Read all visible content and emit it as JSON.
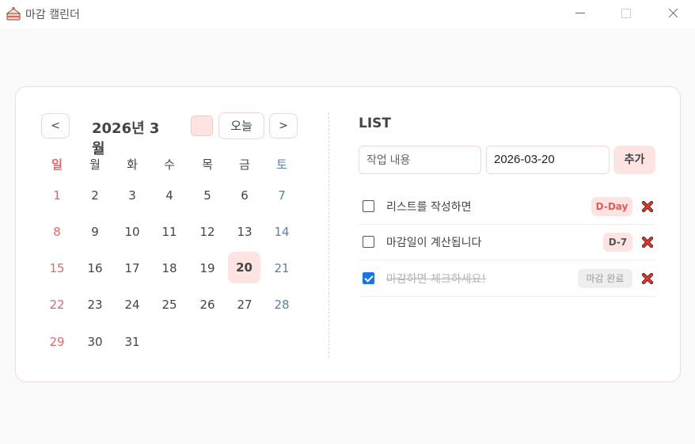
{
  "window": {
    "title": "마감 캘린더",
    "icons": {
      "app": "cake-icon",
      "minimize": "minimize-icon",
      "maximize": "maximize-icon",
      "close": "close-icon"
    }
  },
  "calendar": {
    "prev_label": "<",
    "next_label": ">",
    "title": "2026년 3월",
    "today_label": "오늘",
    "weekdays": [
      "일",
      "월",
      "화",
      "수",
      "목",
      "금",
      "토"
    ],
    "days": [
      "1",
      "2",
      "3",
      "4",
      "5",
      "6",
      "7",
      "8",
      "9",
      "10",
      "11",
      "12",
      "13",
      "14",
      "15",
      "16",
      "17",
      "18",
      "19",
      "20",
      "21",
      "22",
      "23",
      "24",
      "25",
      "26",
      "27",
      "28",
      "29",
      "30",
      "31"
    ],
    "selected_day": "20",
    "colors": {
      "sunday": "#e16868",
      "saturday": "#5a7fa6",
      "highlight": "#fde3e1"
    }
  },
  "list": {
    "title": "LIST",
    "task_placeholder": "작업 내용",
    "date_value": "2026-03-20",
    "add_label": "추가",
    "items": [
      {
        "text": "리스트를 작성하면",
        "badge": "D-Day",
        "checked": false
      },
      {
        "text": "마감일이 계산됩니다",
        "badge": "D-7",
        "checked": false
      },
      {
        "text": "마감하면 체크하세요!",
        "badge": "마감 완료",
        "checked": true
      }
    ],
    "delete_icon": "delete-x-icon"
  }
}
